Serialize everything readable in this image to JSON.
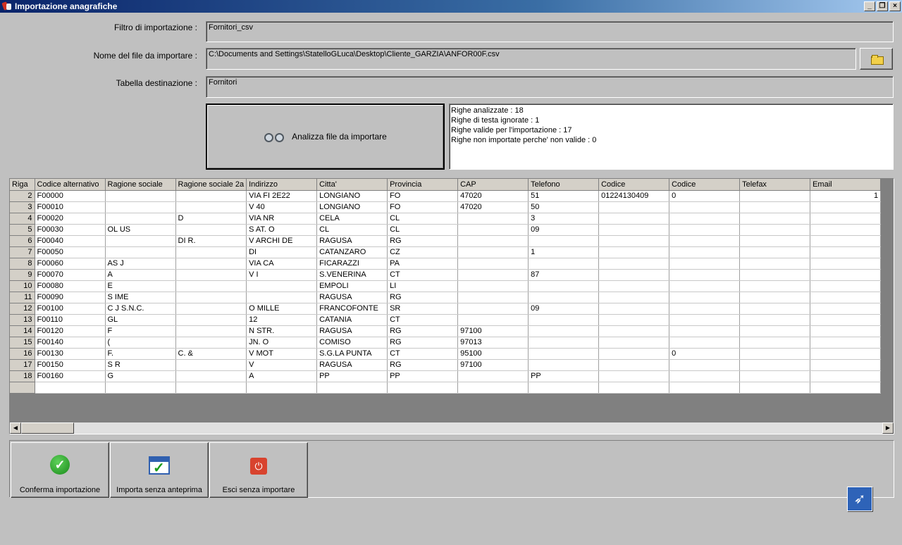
{
  "window": {
    "title": "Importazione anagrafiche",
    "buttons": [
      "_",
      "❐",
      "×"
    ]
  },
  "form": {
    "filter_label": "Filtro di importazione :",
    "filter_value": "Fornitori_csv",
    "file_label": "Nome del file da importare :",
    "file_value": "C:\\Documents and Settings\\StatelloGLuca\\Desktop\\Cliente_GARZIA\\ANFOR00F.csv",
    "table_label": "Tabella destinazione :",
    "table_value": "Fornitori"
  },
  "analyze_button": "Analizza file da importare",
  "stats": [
    "Righe analizzate : 18",
    "Righe di testa ignorate : 1",
    "Righe valide per l'importazione : 17",
    "Righe non importate perche' non valide : 0"
  ],
  "grid": {
    "columns": [
      "Riga",
      "Codice alternativo",
      "Ragione sociale",
      "Ragione sociale 2a",
      "Indirizzo",
      "Citta'",
      "Provincia",
      "CAP",
      "Telefono",
      "Codice",
      "Codice",
      "Telefax",
      "Email"
    ],
    "rows": [
      [
        "2",
        "F00000",
        "",
        "",
        "VIA FI    2E22",
        "LONGIANO",
        "FO",
        "47020",
        "51",
        "01224130409",
        "0",
        "",
        "1"
      ],
      [
        "3",
        "F00010",
        "",
        "",
        "V       40",
        "LONGIANO",
        "FO",
        "47020",
        "50",
        "",
        "",
        "",
        ""
      ],
      [
        "4",
        "F00020",
        "",
        "D",
        "VIA        NR",
        "CELA",
        "CL",
        "",
        "3",
        "",
        "",
        "",
        ""
      ],
      [
        "5",
        "F00030",
        "OL     US",
        "",
        "S   AT.   O",
        "CL",
        "CL",
        "",
        "09",
        "",
        "",
        "",
        ""
      ],
      [
        "6",
        "F00040",
        "",
        "DI R.",
        "V ARCHI   DE",
        "RAGUSA",
        "RG",
        "",
        "",
        "",
        "",
        "",
        ""
      ],
      [
        "7",
        "F00050",
        "",
        "",
        "    DI",
        "CATANZARO",
        "CZ",
        "",
        "1",
        "",
        "",
        "",
        ""
      ],
      [
        "8",
        "F00060",
        "AS   J",
        "",
        "VIA        CA",
        "FICARAZZI",
        "PA",
        "",
        "",
        "",
        "",
        "",
        ""
      ],
      [
        "9",
        "F00070",
        "A",
        "",
        "V     I",
        "S.VENERINA",
        "CT",
        "",
        "87",
        "",
        "",
        "",
        ""
      ],
      [
        "10",
        "F00080",
        "E",
        "",
        "",
        "EMPOLI",
        "LI",
        "",
        "",
        "",
        "",
        "",
        ""
      ],
      [
        "11",
        "F00090",
        "S      IME",
        "",
        "",
        "RAGUSA",
        "RG",
        "",
        "",
        "",
        "",
        "",
        ""
      ],
      [
        "12",
        "F00100",
        "C   J   S.N.C.",
        "",
        "O    MILLE",
        "FRANCOFONTE",
        "SR",
        "",
        "09",
        "",
        "",
        "",
        ""
      ],
      [
        "13",
        "F00110",
        "GL",
        "",
        "12",
        "CATANIA",
        "CT",
        "",
        "",
        "",
        "",
        "",
        ""
      ],
      [
        "14",
        "F00120",
        "F",
        "",
        "N     STR.",
        "RAGUSA",
        "RG",
        "97100",
        "",
        "",
        "",
        "",
        ""
      ],
      [
        "15",
        "F00140",
        "(",
        "",
        "JN.   O",
        "COMISO",
        "RG",
        "97013",
        "",
        "",
        "",
        "",
        ""
      ],
      [
        "16",
        "F00130",
        "F.",
        "C. &",
        "V    MOT",
        "S.G.LA PUNTA",
        "CT",
        "95100",
        "",
        "",
        "0",
        "",
        ""
      ],
      [
        "17",
        "F00150",
        "S    R",
        "",
        "V",
        "RAGUSA",
        "RG",
        "97100",
        "",
        "",
        "",
        "",
        ""
      ],
      [
        "18",
        "F00160",
        "G",
        "",
        "A",
        "PP",
        "PP",
        "",
        "PP",
        "",
        "",
        "",
        ""
      ]
    ]
  },
  "buttons": {
    "confirm": "Conferma importazione",
    "import_no_preview": "Importa senza anteprima",
    "exit": "Esci senza importare"
  },
  "icons": [
    "folder-icon",
    "binoculars-icon",
    "check-icon",
    "calendar-check-icon",
    "power-icon",
    "bird-logo-icon"
  ]
}
